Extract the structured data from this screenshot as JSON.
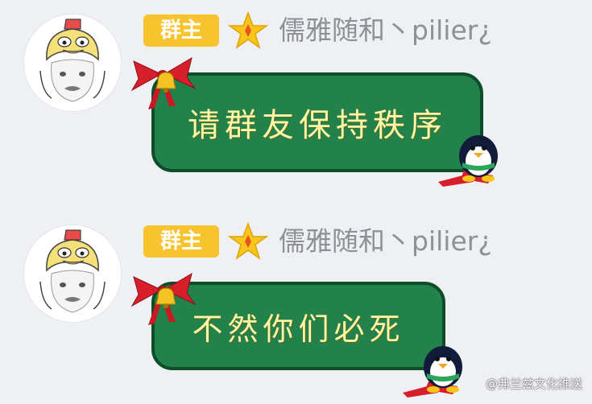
{
  "messages": [
    {
      "badge": "群主",
      "nickname": "儒雅随和丶pilier¿",
      "text": "请群友保持秩序"
    },
    {
      "badge": "群主",
      "nickname": "儒雅随和丶pilier¿",
      "text": "不然你们必死"
    }
  ],
  "watermark": "@弗兰兹文化推送",
  "colors": {
    "background": "#eef0f4",
    "bubble": "#23824b",
    "bubble_border": "#0f4d28",
    "bubble_text": "#fff7a6",
    "badge": "#f7c430",
    "nickname": "#8f9097"
  },
  "icons": {
    "avatar": "cat-with-duck-hat-avatar",
    "level": "star-icon",
    "bubble_decoration_top": "red-bow-bell-icon",
    "bubble_decoration_bottom": "penguin-icon"
  }
}
